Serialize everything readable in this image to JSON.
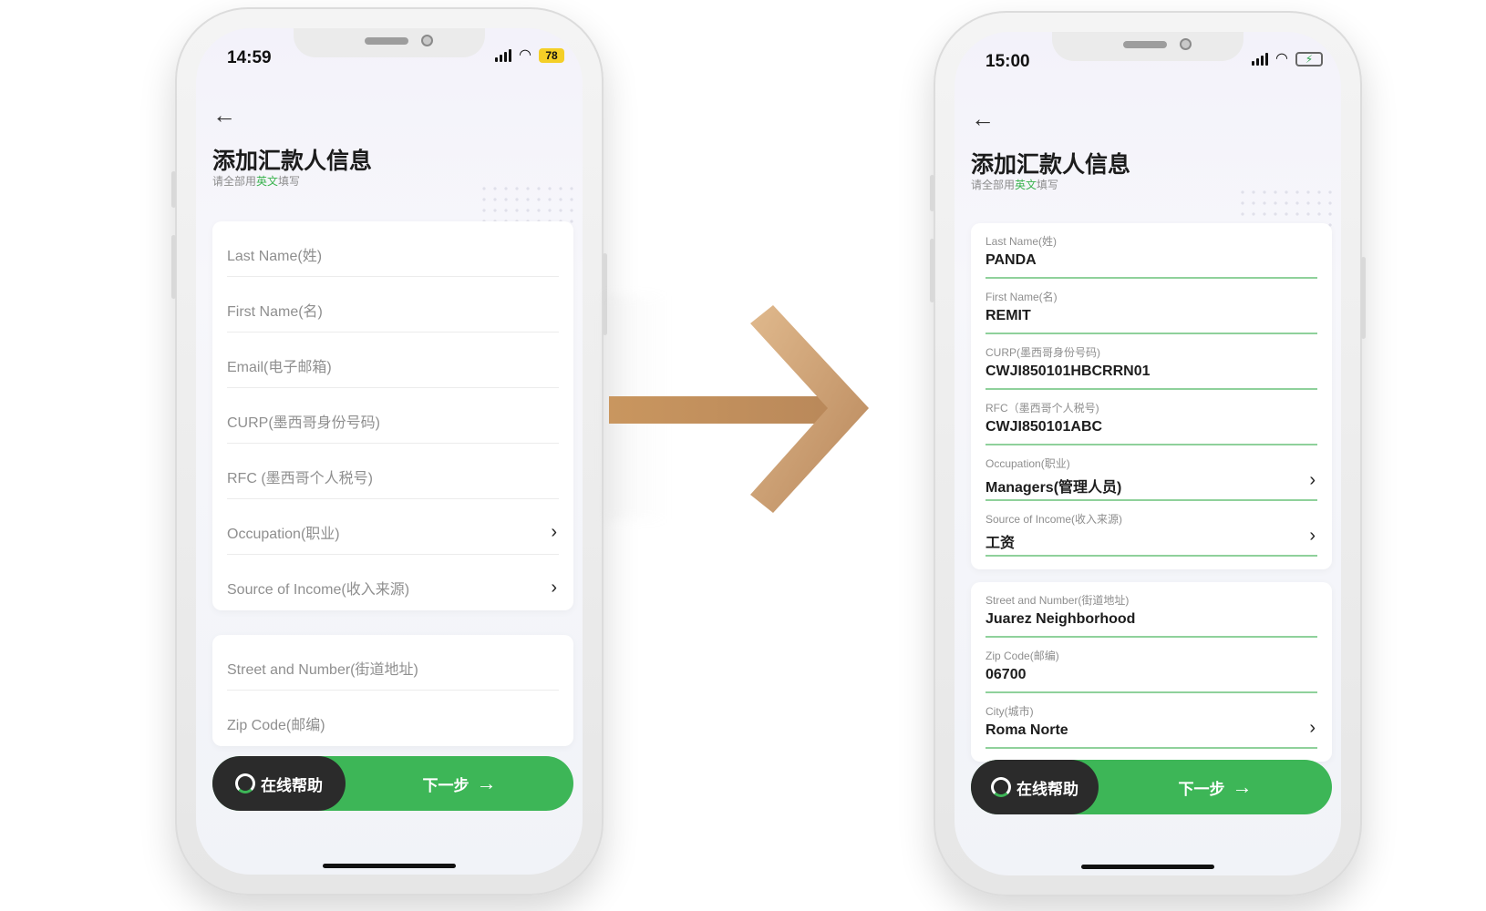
{
  "left_phone": {
    "status": {
      "time": "14:59",
      "battery": "78"
    },
    "title": "添加汇款人信息",
    "subtitle_pre": "请全部用",
    "subtitle_accent": "英文",
    "subtitle_post": "填写",
    "section1": [
      {
        "placeholder": "Last Name(姓)"
      },
      {
        "placeholder": "First Name(名)"
      },
      {
        "placeholder": "Email(电子邮箱)"
      },
      {
        "placeholder": "CURP(墨西哥身份号码)"
      },
      {
        "placeholder": "RFC (墨西哥个人税号)"
      },
      {
        "placeholder": "Occupation(职业)"
      },
      {
        "placeholder": "Source of Income(收入来源)"
      }
    ],
    "section2": [
      {
        "placeholder": "Street and Number(街道地址)"
      },
      {
        "placeholder": "Zip Code(邮编)"
      }
    ],
    "help_label": "在线帮助",
    "next_label": "下一步"
  },
  "right_phone": {
    "status": {
      "time": "15:00"
    },
    "title": "添加汇款人信息",
    "subtitle_pre": "请全部用",
    "subtitle_accent": "英文",
    "subtitle_post": "填写",
    "section1": [
      {
        "label": "Last Name(姓)",
        "value": "PANDA"
      },
      {
        "label": "First Name(名)",
        "value": "REMIT"
      },
      {
        "label": "CURP(墨西哥身份号码)",
        "value": "CWJI850101HBCRRN01"
      },
      {
        "label": "RFC（墨西哥个人税号)",
        "value": "CWJI850101ABC"
      },
      {
        "label": "Occupation(职业)",
        "value": "Managers(管理人员)"
      },
      {
        "label": "Source of Income(收入来源)",
        "value": "工资"
      }
    ],
    "section2": [
      {
        "label": "Street and Number(街道地址)",
        "value": "Juarez Neighborhood"
      },
      {
        "label": "Zip Code(邮编)",
        "value": "06700"
      },
      {
        "label": "City(城市)",
        "value": "Roma Norte"
      }
    ],
    "help_label": "在线帮助",
    "next_label": "下一步"
  },
  "icons": {
    "back": "back-arrow-icon",
    "chevron": "chevron-right-icon",
    "headset": "headset-icon",
    "next": "arrow-right-icon"
  },
  "colors": {
    "accent_green": "#3db657",
    "dark_button": "#2b2b2b",
    "arrow_gold": "#c79a6b"
  }
}
